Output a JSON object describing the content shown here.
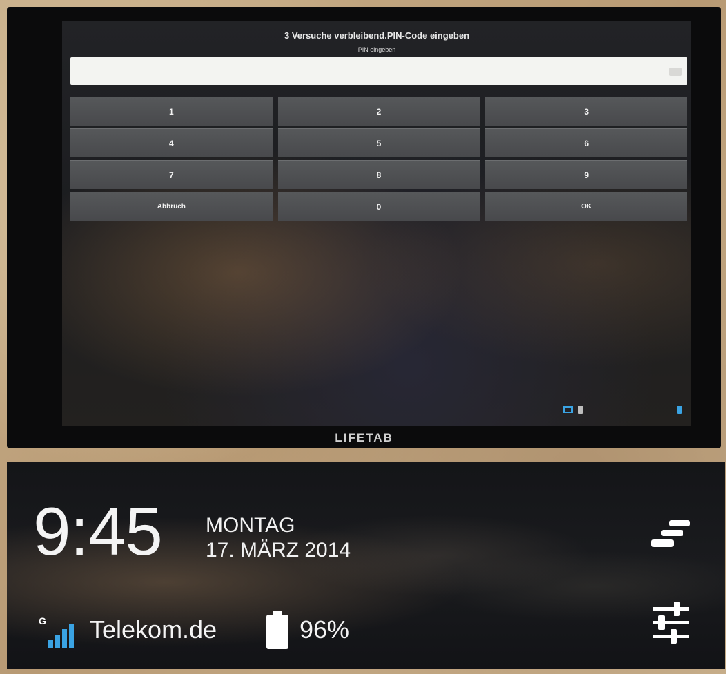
{
  "pin_dialog": {
    "title": "3 Versuche verbleibend.PIN-Code eingeben",
    "subtitle": "PIN eingeben",
    "input_value": "",
    "keys": [
      "1",
      "2",
      "3",
      "4",
      "5",
      "6",
      "7",
      "8",
      "9",
      "Abbruch",
      "0",
      "OK"
    ]
  },
  "device": {
    "brand": "LIFETAB"
  },
  "lockscreen": {
    "time": "9:45",
    "day": "MONTAG",
    "date": "17. MÄRZ 2014",
    "network_type": "G",
    "carrier": "Telekom.de",
    "battery": "96%",
    "icons": [
      "signal-icon",
      "battery-icon",
      "stack-icon",
      "settings-icon"
    ]
  },
  "colors": {
    "accent": "#3aa3e3",
    "key_bg": "#4f5153",
    "text": "#f4f4f4"
  }
}
